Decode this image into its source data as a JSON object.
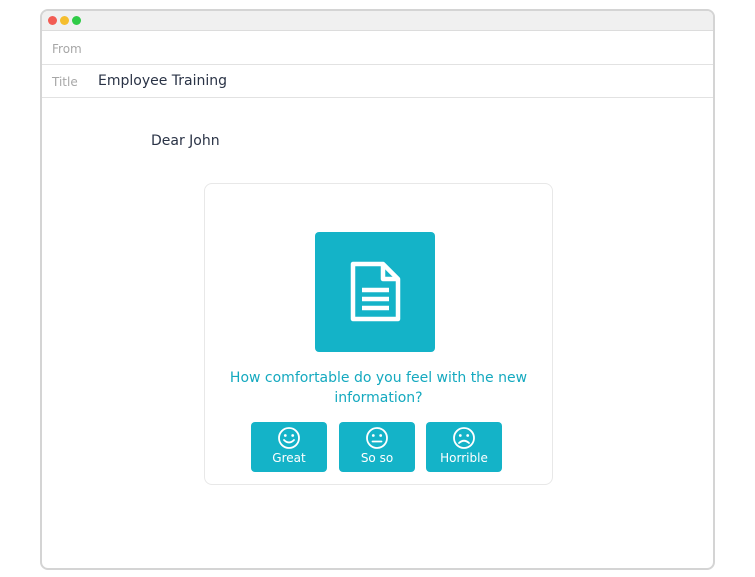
{
  "email": {
    "from_label": "From",
    "from_value": "",
    "title_label": "Title",
    "title_value": "Employee Training",
    "greeting": "Dear John"
  },
  "survey": {
    "icon": "document-icon",
    "question": "How comfortable do you feel with the new information?",
    "choices": [
      {
        "label": "Great",
        "icon": "smile-icon"
      },
      {
        "label": "So so",
        "icon": "neutral-face-icon"
      },
      {
        "label": "Horrible",
        "icon": "frown-icon"
      }
    ]
  },
  "colors": {
    "accent": "#14b3c8",
    "question_text": "#14a9bf",
    "body_text": "#2a3346",
    "label_text": "#a7a7a7"
  }
}
